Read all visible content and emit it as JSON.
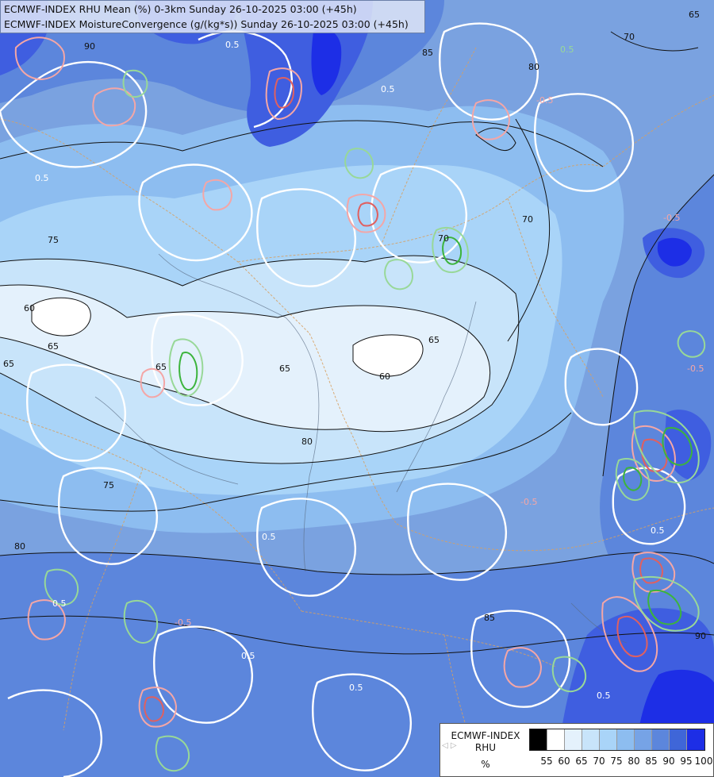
{
  "header": {
    "line1": "ECMWF-INDEX RHU Mean (%) 0-3km Sunday 26-10-2025 03:00 (+45h)",
    "line2": "ECMWF-INDEX MoistureConvergence (g/(kg*s)) Sunday 26-10-2025 03:00 (+45h)"
  },
  "legend": {
    "title_line1": "ECMWF-INDEX",
    "title_line2": "RHU",
    "unit": "%",
    "arrows": "◁ ▷",
    "swatch_colors": [
      "#000000",
      "#ffffff",
      "#e4f1fc",
      "#c8e4fa",
      "#a9d4f8",
      "#8dbdf0",
      "#76a3e6",
      "#5c86dc",
      "#3f66d8",
      "#1d2ee6"
    ],
    "ticks": [
      "55",
      "60",
      "65",
      "70",
      "75",
      "80",
      "85",
      "90",
      "95",
      "100"
    ]
  },
  "map": {
    "fill_colors": {
      "rh_55_60": "#ffffff",
      "rh_60_65": "#e4f1fc",
      "rh_65_70": "#c8e4fa",
      "rh_70_75": "#a9d4f8",
      "rh_75_80": "#8dbdf0",
      "rh_80_85": "#7aa2e0",
      "rh_85_90": "#5c86dc",
      "rh_90_95": "#3f5ee0",
      "rh_95_100": "#1d2ee6"
    },
    "contour_labels": [
      "65",
      "65",
      "80",
      "90",
      "70",
      "85",
      "70",
      "75",
      "65",
      "60",
      "65",
      "65",
      "60",
      "80",
      "80",
      "70",
      "75",
      "65",
      "85",
      "90",
      "0.5",
      "0.5",
      "0.5",
      "-0.5",
      "-0.5",
      "0.5",
      "0.5",
      "-0.5",
      "0.5",
      "0.5",
      "0.5",
      "-0.5",
      "-0.5",
      "0.5",
      "0.5"
    ]
  }
}
